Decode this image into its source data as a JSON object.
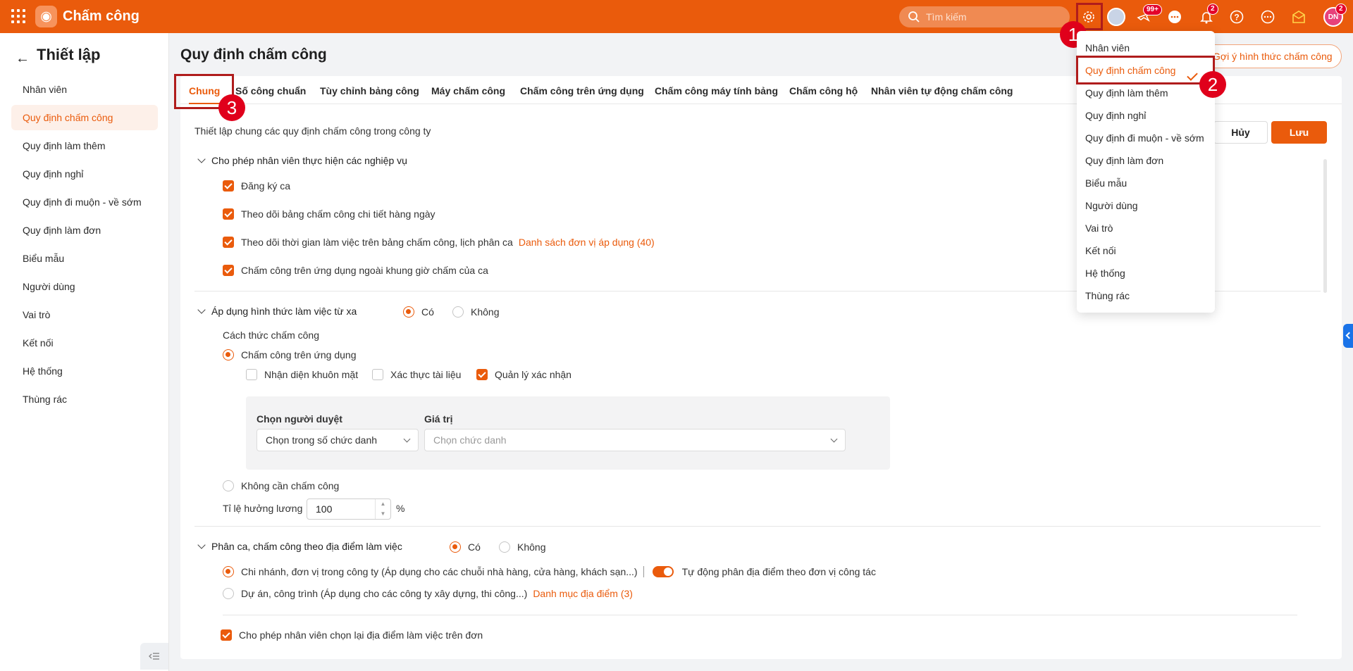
{
  "app": {
    "title": "Chấm công",
    "search_placeholder": "Tìm kiếm"
  },
  "header_badges": {
    "flight": "99+",
    "notifications": "2",
    "avatar_initials": "DN",
    "avatar_badge": "2"
  },
  "annotations": {
    "n1": "1",
    "n2": "2",
    "n3": "3"
  },
  "sidebar": {
    "title": "Thiết lập",
    "items": [
      "Nhân viên",
      "Quy định chấm công",
      "Quy định làm thêm",
      "Quy định nghỉ",
      "Quy định đi muộn - về sớm",
      "Quy định làm đơn",
      "Biểu mẫu",
      "Người dùng",
      "Vai trò",
      "Kết nối",
      "Hệ thống",
      "Thùng rác"
    ],
    "active_index": 1
  },
  "main": {
    "title": "Quy định chấm công",
    "suggest_button": "Gợi ý hình thức chấm công",
    "tabs": [
      "Chung",
      "Số công chuẩn",
      "Tùy chỉnh bảng công",
      "Máy chấm công",
      "Chấm công trên ứng dụng",
      "Chấm công máy tính bảng",
      "Chấm công hộ",
      "Nhân viên tự động chấm công"
    ],
    "description": "Thiết lập chung các quy định chấm công trong công ty",
    "cancel": "Hủy",
    "save": "Lưu",
    "section1": {
      "title": "Cho phép nhân viên thực hiện các nghiệp vụ",
      "items": [
        "Đăng ký ca",
        "Theo dõi bảng chấm công chi tiết hàng ngày",
        "Theo dõi thời gian làm việc trên bảng chấm công, lịch phân ca",
        "Chấm công trên ứng dụng ngoài khung giờ chấm của ca"
      ],
      "link": "Danh sách đơn vị áp dụng (40)"
    },
    "section2": {
      "title": "Áp dụng hình thức làm việc từ xa",
      "yes": "Có",
      "no": "Không",
      "method_label": "Cách thức chấm công",
      "app_option": "Chấm công trên ứng dụng",
      "face": "Nhận diện khuôn mặt",
      "doc": "Xác thực tài liệu",
      "manager": "Quản lý xác nhận",
      "approver_label": "Chọn người duyệt",
      "value_label": "Giá trị",
      "approver_value": "Chọn trong số chức danh",
      "value_placeholder": "Chọn chức danh",
      "no_need": "Không cần chấm công",
      "salary_label": "Tỉ lệ hưởng lương",
      "salary_value": "100",
      "percent": "%"
    },
    "section3": {
      "title": "Phân ca, chấm công theo địa điểm làm việc",
      "yes": "Có",
      "no": "Không",
      "opt1": "Chi nhánh, đơn vị trong công ty (Áp dụng cho các chuỗi nhà hàng, cửa hàng, khách sạn...)",
      "auto": "Tự động phân địa điểm theo đơn vị công tác",
      "opt2": "Dự án, công trình (Áp dụng cho các công ty xây dựng, thi công...)",
      "opt2_link": "Danh mục địa điểm (3)",
      "reselect": "Cho phép nhân viên chọn lại địa điểm làm việc trên đơn"
    }
  },
  "dropdown": {
    "items": [
      "Nhân viên",
      "Quy định chấm công",
      "Quy định làm thêm",
      "Quy định nghỉ",
      "Quy định đi muộn - về sớm",
      "Quy định làm đơn",
      "Biểu mẫu",
      "Người dùng",
      "Vai trò",
      "Kết nối",
      "Hệ thống",
      "Thùng rác"
    ],
    "active_index": 1
  },
  "colors": {
    "brand": "#ea5b0c",
    "highlight": "#b01c1c",
    "marker": "#e0001b"
  }
}
